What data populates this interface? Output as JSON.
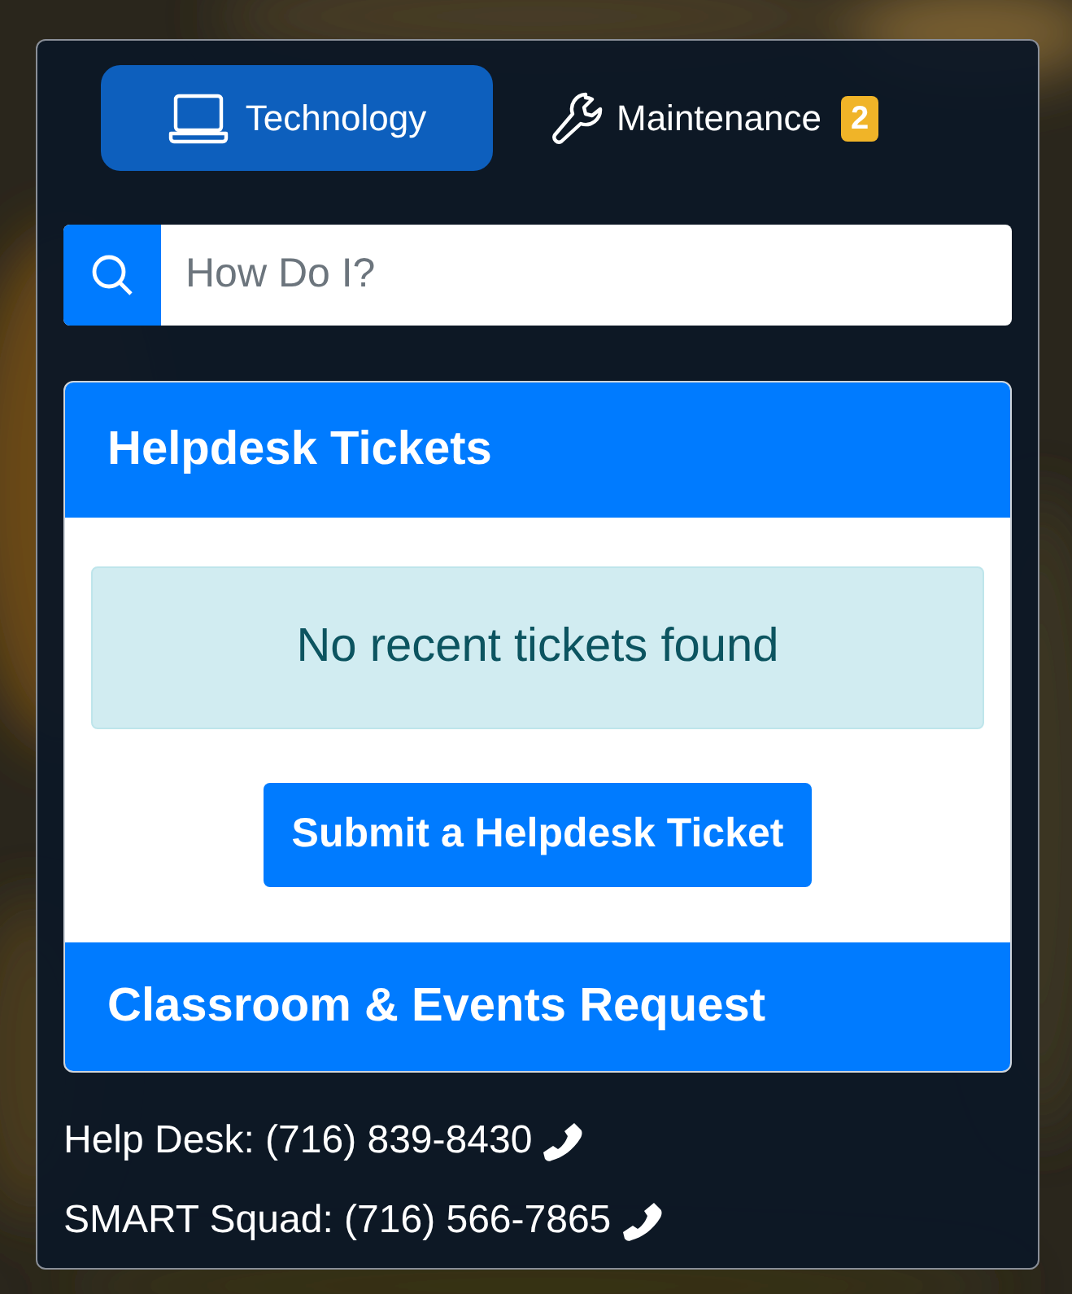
{
  "tabs": [
    {
      "label": "Technology",
      "selected": true
    },
    {
      "label": "Maintenance",
      "selected": false,
      "badge": "2"
    }
  ],
  "search": {
    "placeholder": "How Do I?"
  },
  "sections": [
    {
      "title": "Helpdesk Tickets",
      "alert": "No recent tickets found",
      "button": "Submit a Helpdesk Ticket"
    },
    {
      "title": "Classroom & Events Request"
    }
  ],
  "contacts": [
    {
      "label": "Help Desk: (716) 839-8430"
    },
    {
      "label": "SMART Squad: (716) 566-7865"
    }
  ]
}
